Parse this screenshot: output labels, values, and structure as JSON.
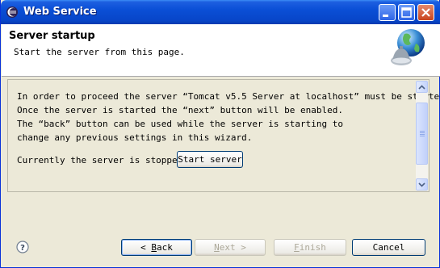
{
  "window": {
    "title": "Web Service"
  },
  "header": {
    "title": "Server startup",
    "description": "Start the server from this page."
  },
  "content": {
    "message_lines": [
      "In order to proceed the server “Tomcat v5.5 Server at localhost” must be started.",
      "Once the server is started the “next” button will be enabled.",
      "The “back” button can be used while the server is starting to",
      "change any previous settings in this wizard."
    ],
    "status_text": "Currently the server is stopped.",
    "start_button": "Start server"
  },
  "buttons": {
    "back": {
      "prefix": "< ",
      "mnemonic": "B",
      "rest": "ack",
      "enabled": true
    },
    "next": {
      "mnemonic": "N",
      "rest": "ext >",
      "enabled": false
    },
    "finish": {
      "mnemonic": "F",
      "rest": "inish",
      "enabled": false
    },
    "cancel": {
      "label": "Cancel",
      "enabled": true
    }
  }
}
